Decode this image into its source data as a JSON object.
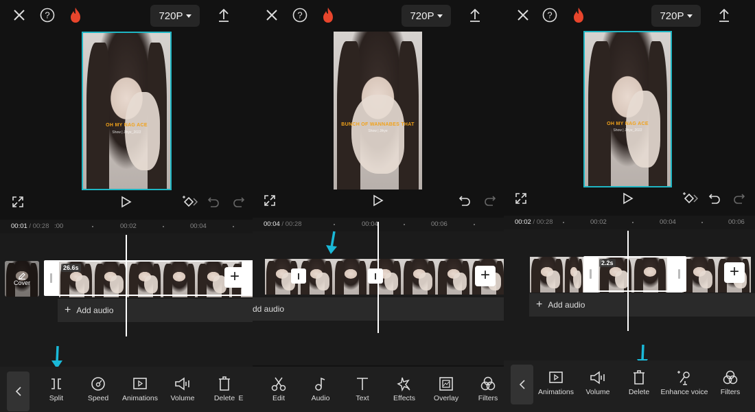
{
  "panels": [
    {
      "header": {
        "resolution": "720P"
      },
      "preview": {
        "caption": "OH MY NAG ACE",
        "subcaption": "Show | Jihye_2022",
        "selected": true
      },
      "ruler": {
        "current": "00:01",
        "total": "00:28",
        "ticks": [
          ":00",
          "00:02",
          "00:04"
        ]
      },
      "timeline": {
        "duration_badge": "26.6s",
        "cover_label": "Cover",
        "add_audio": "Add audio"
      },
      "toolbar": {
        "items": [
          {
            "label": "Split",
            "icon": "split-icon"
          },
          {
            "label": "Speed",
            "icon": "speed-icon"
          },
          {
            "label": "Animations",
            "icon": "animations-icon"
          },
          {
            "label": "Volume",
            "icon": "volume-icon"
          },
          {
            "label": "Delete",
            "icon": "delete-icon"
          },
          {
            "label": "E",
            "icon": ""
          }
        ]
      },
      "annotation": {
        "arrow_target": "Split",
        "color": "#1ab9d8"
      }
    },
    {
      "header": {
        "resolution": "720P"
      },
      "preview": {
        "caption": "BUNCH OF WANNABES THAT",
        "subcaption": "Show | Jihye",
        "selected": false
      },
      "ruler": {
        "current": "00:04",
        "total": "00:28",
        "ticks": [
          "00:04",
          "00:06"
        ]
      },
      "timeline": {
        "add_audio": "dd audio"
      },
      "toolbar": {
        "items": [
          {
            "label": "Edit",
            "icon": "scissors-icon"
          },
          {
            "label": "Audio",
            "icon": "music-note-icon"
          },
          {
            "label": "Text",
            "icon": "text-icon"
          },
          {
            "label": "Effects",
            "icon": "effects-star-icon"
          },
          {
            "label": "Overlay",
            "icon": "overlay-icon"
          },
          {
            "label": "Filters",
            "icon": "filters-icon"
          }
        ]
      },
      "annotation": {
        "arrow_target": "split point",
        "color": "#1ab9d8"
      }
    },
    {
      "header": {
        "resolution": "720P"
      },
      "preview": {
        "caption": "OH MY NAG ACE",
        "subcaption": "Show | Jihye_2022",
        "selected": true
      },
      "ruler": {
        "current": "00:02",
        "total": "00:28",
        "ticks": [
          "00:02",
          "00:04",
          "00:06"
        ]
      },
      "timeline": {
        "duration_badge": "2.2s",
        "add_audio": "Add audio"
      },
      "toolbar": {
        "items": [
          {
            "label": "Animations",
            "icon": "animations-icon"
          },
          {
            "label": "Volume",
            "icon": "volume-icon"
          },
          {
            "label": "Delete",
            "icon": "delete-icon"
          },
          {
            "label": "Enhance voice",
            "icon": "enhance-voice-icon"
          },
          {
            "label": "Filters",
            "icon": "filters-icon"
          }
        ]
      },
      "annotation": {
        "arrow_target": "Delete",
        "color": "#1ab9d8"
      }
    }
  ],
  "colors": {
    "accent": "#1ab9d8",
    "selection": "#1fb6c4",
    "fire": "#e8452c",
    "background": "#121212"
  }
}
